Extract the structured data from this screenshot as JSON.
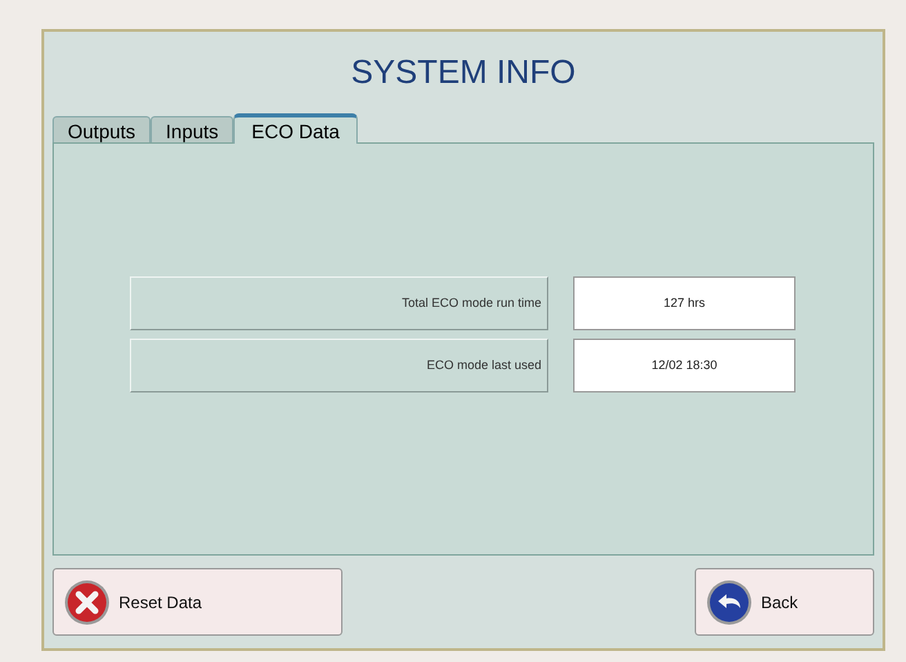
{
  "title": "SYSTEM INFO",
  "tabs": [
    {
      "label": "Outputs",
      "selected": false
    },
    {
      "label": "Inputs",
      "selected": false
    },
    {
      "label": "ECO Data",
      "selected": true
    }
  ],
  "rows": [
    {
      "label": "Total ECO mode run time",
      "value": "127 hrs"
    },
    {
      "label": "ECO mode last used",
      "value": "12/02 18:30"
    }
  ],
  "buttons": [
    {
      "kind": "reset",
      "label": "Reset Data"
    },
    {
      "kind": "back",
      "label": "Back"
    }
  ]
}
